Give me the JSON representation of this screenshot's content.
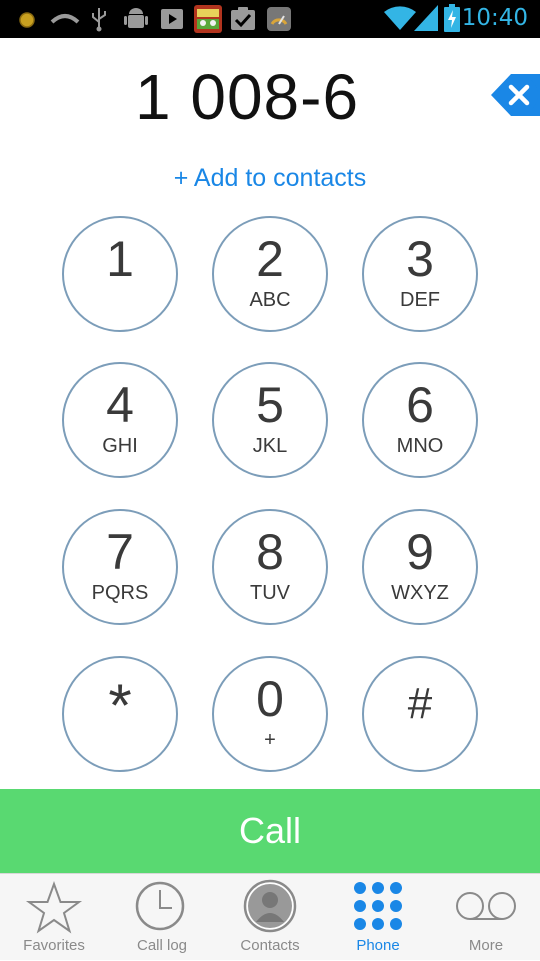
{
  "status_bar": {
    "time": "10:40",
    "icons": [
      "notification-dot-icon",
      "voicemail-icon",
      "usb-icon",
      "android-debug-icon",
      "play-store-icon",
      "game-app-icon",
      "task-check-icon",
      "gauge-app-icon",
      "wifi-icon",
      "signal-icon",
      "battery-charging-icon"
    ]
  },
  "dialer": {
    "number": "1 008-6",
    "add_to_contacts": "+ Add to contacts",
    "keys": [
      {
        "digit": "1",
        "letters": ""
      },
      {
        "digit": "2",
        "letters": "ABC"
      },
      {
        "digit": "3",
        "letters": "DEF"
      },
      {
        "digit": "4",
        "letters": "GHI"
      },
      {
        "digit": "5",
        "letters": "JKL"
      },
      {
        "digit": "6",
        "letters": "MNO"
      },
      {
        "digit": "7",
        "letters": "PQRS"
      },
      {
        "digit": "8",
        "letters": "TUV"
      },
      {
        "digit": "9",
        "letters": "WXYZ"
      },
      {
        "digit": "*",
        "letters": ""
      },
      {
        "digit": "0",
        "letters": "+"
      },
      {
        "digit": "#",
        "letters": ""
      }
    ],
    "call_label": "Call"
  },
  "tabs": [
    {
      "label": "Favorites",
      "icon": "star-icon"
    },
    {
      "label": "Call log",
      "icon": "clock-icon"
    },
    {
      "label": "Contacts",
      "icon": "contact-avatar-icon"
    },
    {
      "label": "Phone",
      "icon": "keypad-icon",
      "active": true
    },
    {
      "label": "More",
      "icon": "voicemail-icon"
    }
  ],
  "colors": {
    "accent": "#1a87e6",
    "call_green": "#59d971",
    "key_border": "#7c9db9",
    "status_time": "#33b5e5"
  }
}
